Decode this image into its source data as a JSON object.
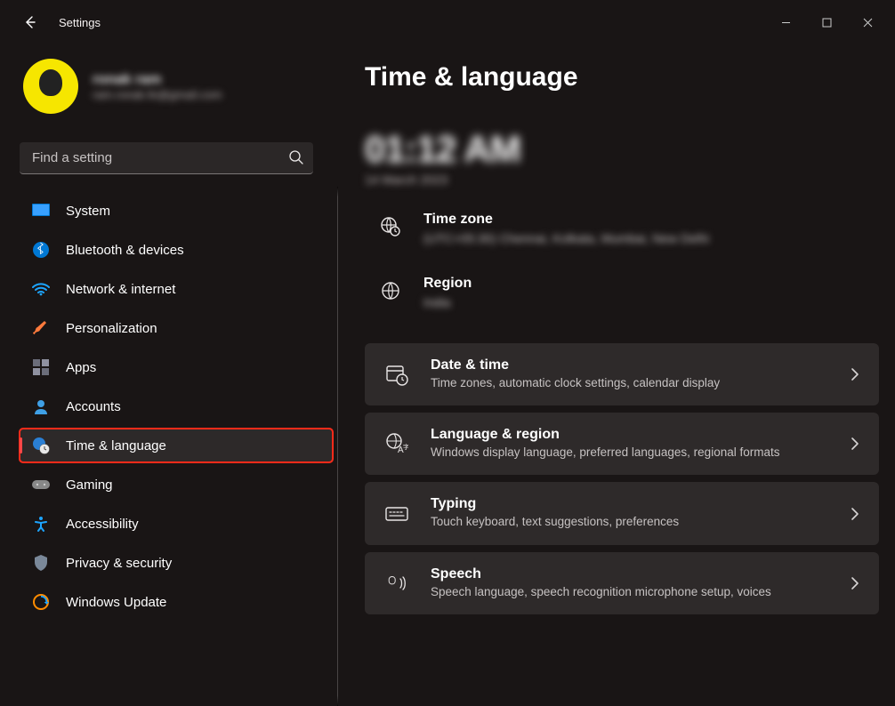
{
  "window": {
    "app_title": "Settings",
    "page_title": "Time & language"
  },
  "user": {
    "name": "ronak ram",
    "email": "ram.ronak.fe@gmail.com"
  },
  "search": {
    "placeholder": "Find a setting"
  },
  "sidebar": [
    {
      "label": "System",
      "icon": "display"
    },
    {
      "label": "Bluetooth & devices",
      "icon": "bluetooth"
    },
    {
      "label": "Network & internet",
      "icon": "wifi"
    },
    {
      "label": "Personalization",
      "icon": "brush"
    },
    {
      "label": "Apps",
      "icon": "apps"
    },
    {
      "label": "Accounts",
      "icon": "person"
    },
    {
      "label": "Time & language",
      "icon": "clock-globe",
      "active": true
    },
    {
      "label": "Gaming",
      "icon": "gamepad"
    },
    {
      "label": "Accessibility",
      "icon": "accessibility"
    },
    {
      "label": "Privacy & security",
      "icon": "shield"
    },
    {
      "label": "Windows Update",
      "icon": "update"
    }
  ],
  "clock": {
    "time": "01:12 AM",
    "date": "14 March 2023"
  },
  "info": [
    {
      "title": "Time zone",
      "desc": "(UTC+05:30) Chennai, Kolkata, Mumbai, New Delhi",
      "icon": "timezone"
    },
    {
      "title": "Region",
      "desc": "India",
      "icon": "globe"
    }
  ],
  "cards": [
    {
      "title": "Date & time",
      "desc": "Time zones, automatic clock settings, calendar display",
      "icon": "date-time"
    },
    {
      "title": "Language & region",
      "desc": "Windows display language, preferred languages, regional formats",
      "icon": "language"
    },
    {
      "title": "Typing",
      "desc": "Touch keyboard, text suggestions, preferences",
      "icon": "keyboard"
    },
    {
      "title": "Speech",
      "desc": "Speech language, speech recognition microphone setup, voices",
      "icon": "speech"
    }
  ]
}
